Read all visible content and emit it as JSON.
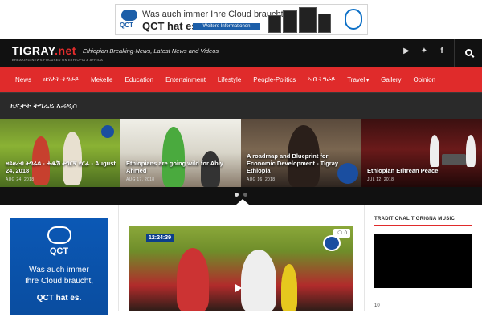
{
  "top_ad": {
    "brand": "QCT",
    "line1": "Was auch immer Ihre Cloud braucht,",
    "line2": "QCT hat es.",
    "button": "Weitere Informationen",
    "partner": "intel"
  },
  "header": {
    "logo_main": "TIGRAY",
    "logo_tld": ".net",
    "logo_sub": "BREAKING NEWS FOCUSED ON ETHIOPIA & AFRICA",
    "tagline": "Ethiopian Breaking-News, Latest News and Videos",
    "social": [
      {
        "name": "youtube-icon",
        "glyph": "▶"
      },
      {
        "name": "twitter-icon",
        "glyph": "🐦"
      },
      {
        "name": "facebook-icon",
        "glyph": "f"
      }
    ],
    "search_icon": "search-icon"
  },
  "nav": {
    "items": [
      {
        "label": "News"
      },
      {
        "label": "ዜናታት-ትግራይ"
      },
      {
        "label": "Mekelle"
      },
      {
        "label": "Education"
      },
      {
        "label": "Entertainment"
      },
      {
        "label": "Lifestyle"
      },
      {
        "label": "People-Politics"
      },
      {
        "label": "ኣብ ትግራይ"
      },
      {
        "label": "Travel",
        "dropdown": true
      },
      {
        "label": "Gallery"
      },
      {
        "label": "Opinion"
      }
    ]
  },
  "section": {
    "title": "ዜናታት ትግራይ ኣዳዲስ"
  },
  "carousel": {
    "slides": [
      {
        "title": "ዘይዛረብ ትግራይ - ሓዱሽ ትግርኛ ደርፊ - August 24, 2018",
        "date": "AUG 24, 2018"
      },
      {
        "title": "Ethiopians are going wild for Abiy Ahmed",
        "date": "AUG 17, 2018"
      },
      {
        "title": "A roadmap and Blueprint for Economic Development - Tigray Ethiopia",
        "date": "AUG 16, 2018"
      },
      {
        "title": "Ethiopian Eritrean Peace",
        "date": "JUL 12, 2018"
      }
    ]
  },
  "side_ad": {
    "brand": "QCT",
    "line1a": "Was auch immer",
    "line1b": "Ihre Cloud braucht,",
    "line2": "QCT hat es."
  },
  "feature": {
    "timestamp": "12:24:39",
    "comment_count": "0"
  },
  "sidebar": {
    "heading": "TRADITIONAL TIGRIGNA MUSIC",
    "next": "10"
  }
}
